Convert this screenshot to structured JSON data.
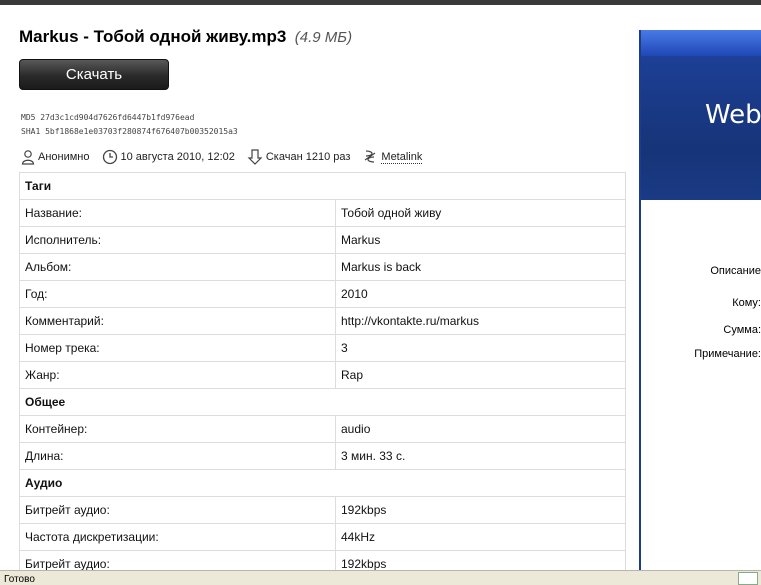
{
  "file": {
    "title": "Markus - Тобой одной живу.mp3",
    "size": "(4.9 МБ)",
    "download_label": "Скачать",
    "md5": "MD5  27d3c1cd904d7626fd6447b1fd976ead",
    "sha1": "SHA1 5bf1868e1e03703f280874f676407b00352015a3"
  },
  "meta": {
    "author": "Анонимно",
    "date": "10 августа 2010, 12:02",
    "downloads": "Скачан 1210 раз",
    "metalink": "Metalink"
  },
  "table": {
    "sections": [
      {
        "title": "Таги",
        "rows": [
          {
            "label": "Название:",
            "value": "Тобой одной живу"
          },
          {
            "label": "Исполнитель:",
            "value": "Markus"
          },
          {
            "label": "Альбом:",
            "value": "Markus is back"
          },
          {
            "label": "Год:",
            "value": "2010"
          },
          {
            "label": "Комментарий:",
            "value": "http://vkontakte.ru/markus"
          },
          {
            "label": "Номер трека:",
            "value": "3"
          },
          {
            "label": "Жанр:",
            "value": "Rap"
          }
        ]
      },
      {
        "title": "Общее",
        "rows": [
          {
            "label": "Контейнер:",
            "value": "audio"
          },
          {
            "label": "Длина:",
            "value": "3 мин. 33 с."
          }
        ]
      },
      {
        "title": "Аудио",
        "rows": [
          {
            "label": "Битрейт аудио:",
            "value": "192kbps"
          },
          {
            "label": "Частота дискретизации:",
            "value": "44kHz"
          },
          {
            "label": "Битрейт аудио:",
            "value": "192kbps"
          }
        ]
      }
    ]
  },
  "side_panel": {
    "logo": "Web",
    "labels": [
      "Описание",
      "Кому:",
      "Сумма:",
      "Примечание:"
    ]
  },
  "status": {
    "text": "Готово"
  },
  "colors": {
    "panel_blue": "#1c3c8e",
    "button_dark": "#2a2a2a"
  }
}
